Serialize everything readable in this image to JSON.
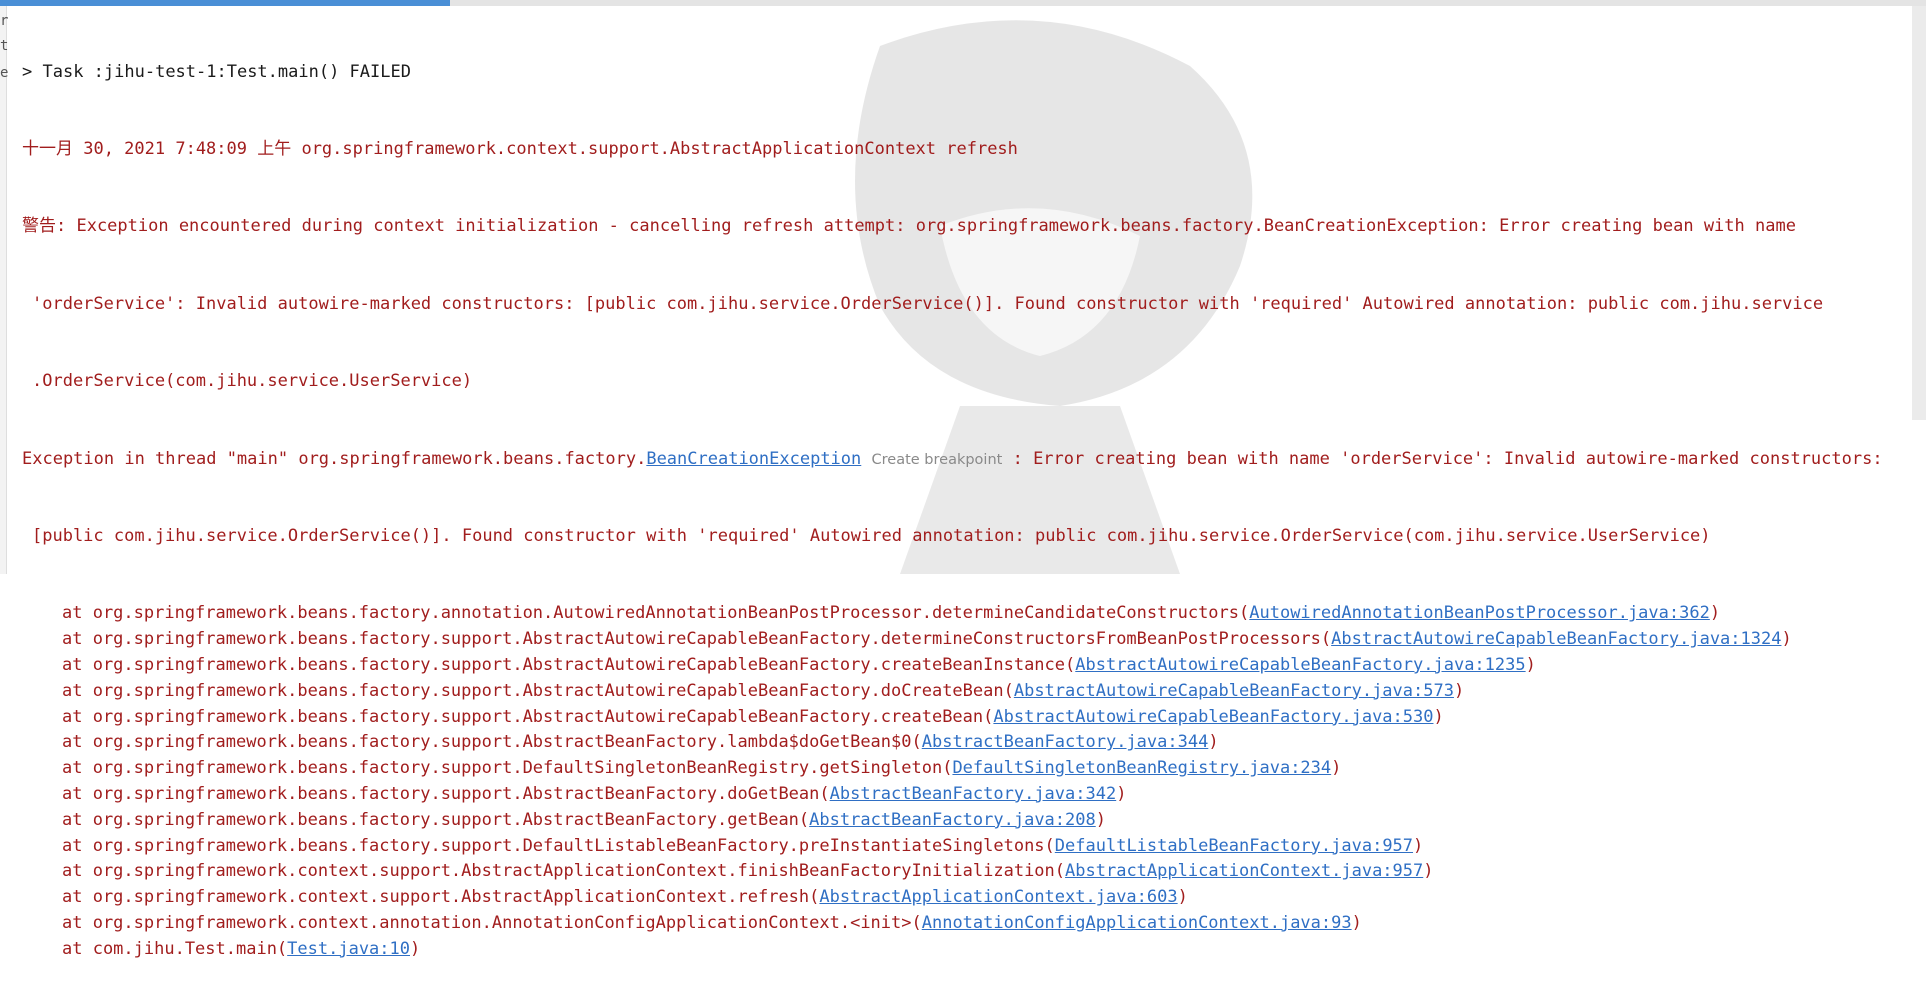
{
  "task_header": {
    "chevron": ">",
    "text": "Task :jihu-test-1:Test.main() FAILED"
  },
  "timestamp_line": "十一月 30, 2021 7:48:09 上午 org.springframework.context.support.AbstractApplicationContext refresh",
  "warning": [
    "警告: Exception encountered during context initialization - cancelling refresh attempt: org.springframework.beans.factory.BeanCreationException: Error creating bean with name",
    "'orderService': Invalid autowire-marked constructors: [public com.jihu.service.OrderService()]. Found constructor with 'required' Autowired annotation: public com.jihu.service",
    ".OrderService(com.jihu.service.UserService)"
  ],
  "exception": {
    "prefix": "Exception in thread \"main\" org.springframework.beans.factory.",
    "class_link": "BeanCreationException",
    "breakpoint_hint": "Create breakpoint",
    "message": ": Error creating bean with name 'orderService': Invalid autowire-marked constructors:",
    "continuation": "[public com.jihu.service.OrderService()]. Found constructor with 'required' Autowired annotation: public com.jihu.service.OrderService(com.jihu.service.UserService)"
  },
  "stack_frames": [
    {
      "method": "at org.springframework.beans.factory.annotation.AutowiredAnnotationBeanPostProcessor.determineCandidateConstructors(",
      "link": "AutowiredAnnotationBeanPostProcessor.java:362",
      "suffix": ")"
    },
    {
      "method": "at org.springframework.beans.factory.support.AbstractAutowireCapableBeanFactory.determineConstructorsFromBeanPostProcessors(",
      "link": "AbstractAutowireCapableBeanFactory.java:1324",
      "suffix": ")"
    },
    {
      "method": "at org.springframework.beans.factory.support.AbstractAutowireCapableBeanFactory.createBeanInstance(",
      "link": "AbstractAutowireCapableBeanFactory.java:1235",
      "suffix": ")"
    },
    {
      "method": "at org.springframework.beans.factory.support.AbstractAutowireCapableBeanFactory.doCreateBean(",
      "link": "AbstractAutowireCapableBeanFactory.java:573",
      "suffix": ")"
    },
    {
      "method": "at org.springframework.beans.factory.support.AbstractAutowireCapableBeanFactory.createBean(",
      "link": "AbstractAutowireCapableBeanFactory.java:530",
      "suffix": ")"
    },
    {
      "method": "at org.springframework.beans.factory.support.AbstractBeanFactory.lambda$doGetBean$0(",
      "link": "AbstractBeanFactory.java:344",
      "suffix": ")"
    },
    {
      "method": "at org.springframework.beans.factory.support.DefaultSingletonBeanRegistry.getSingleton(",
      "link": "DefaultSingletonBeanRegistry.java:234",
      "suffix": ")"
    },
    {
      "method": "at org.springframework.beans.factory.support.AbstractBeanFactory.doGetBean(",
      "link": "AbstractBeanFactory.java:342",
      "suffix": ")"
    },
    {
      "method": "at org.springframework.beans.factory.support.AbstractBeanFactory.getBean(",
      "link": "AbstractBeanFactory.java:208",
      "suffix": ")"
    },
    {
      "method": "at org.springframework.beans.factory.support.DefaultListableBeanFactory.preInstantiateSingletons(",
      "link": "DefaultListableBeanFactory.java:957",
      "suffix": ")"
    },
    {
      "method": "at org.springframework.context.support.AbstractApplicationContext.finishBeanFactoryInitialization(",
      "link": "AbstractApplicationContext.java:957",
      "suffix": ")"
    },
    {
      "method": "at org.springframework.context.support.AbstractApplicationContext.refresh(",
      "link": "AbstractApplicationContext.java:603",
      "suffix": ")"
    },
    {
      "method": "at org.springframework.context.annotation.AnnotationConfigApplicationContext.<init>(",
      "link": "AnnotationConfigApplicationContext.java:93",
      "suffix": ")"
    },
    {
      "method": "at com.jihu.Test.main(",
      "link": "Test.java:10",
      "suffix": ")"
    }
  ],
  "gutter_glyphs": [
    "r",
    "t",
    "e"
  ],
  "colors": {
    "error_text": "#a11d1d",
    "link": "#2f6fc4",
    "hint": "#8a8a8a",
    "progress": "#4a8fd6"
  }
}
